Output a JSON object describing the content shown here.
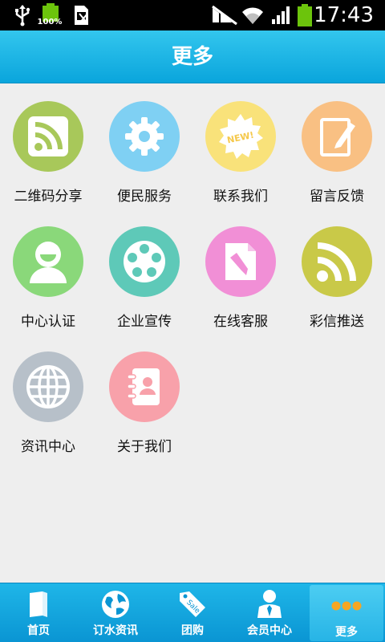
{
  "status_bar": {
    "battery_percent_label": "100%",
    "time": "17:43"
  },
  "header": {
    "title": "更多"
  },
  "grid": {
    "items": [
      {
        "label": "二维码分享",
        "icon": "rss-icon",
        "color": "#a8c85a"
      },
      {
        "label": "便民服务",
        "icon": "gear-icon",
        "color": "#7fd0f3"
      },
      {
        "label": "联系我们",
        "icon": "new-badge-icon",
        "color": "#f9e27a"
      },
      {
        "label": "留言反馈",
        "icon": "edit-note-icon",
        "color": "#f9c083"
      },
      {
        "label": "中心认证",
        "icon": "user-icon",
        "color": "#8ad87a"
      },
      {
        "label": "企业宣传",
        "icon": "film-reel-icon",
        "color": "#5ec9b8"
      },
      {
        "label": "在线客服",
        "icon": "document-pencil-icon",
        "color": "#f18fd6"
      },
      {
        "label": "彩信推送",
        "icon": "rss-icon",
        "color": "#c9c948"
      },
      {
        "label": "资讯中心",
        "icon": "globe-icon",
        "color": "#b7c0c9"
      },
      {
        "label": "关于我们",
        "icon": "contacts-book-icon",
        "color": "#f8a1aa"
      }
    ]
  },
  "tabbar": {
    "tabs": [
      {
        "label": "首页",
        "icon": "book-icon",
        "active": false
      },
      {
        "label": "订水资讯",
        "icon": "globe-icon",
        "active": false
      },
      {
        "label": "团购",
        "icon": "sale-tag-icon",
        "active": false
      },
      {
        "label": "会员中心",
        "icon": "member-icon",
        "active": false
      },
      {
        "label": "更多",
        "icon": "more-dots-icon",
        "active": true
      }
    ]
  }
}
